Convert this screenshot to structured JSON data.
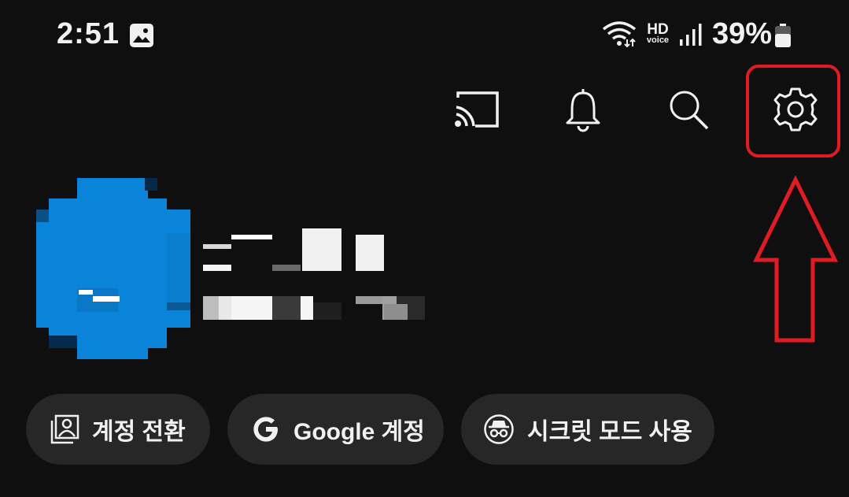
{
  "status_bar": {
    "time": "2:51",
    "network_badge_top": "HD",
    "network_badge_bottom": "voice",
    "battery": "39%"
  },
  "header_icons": [
    "cast-icon",
    "bell-icon",
    "search-icon",
    "settings-icon"
  ],
  "annotation_color": "#e01b24",
  "avatar_color": "#0a84d8",
  "chips": {
    "switch_account": "계정 전환",
    "google_account": "Google 계정",
    "incognito": "시크릿 모드 사용"
  }
}
